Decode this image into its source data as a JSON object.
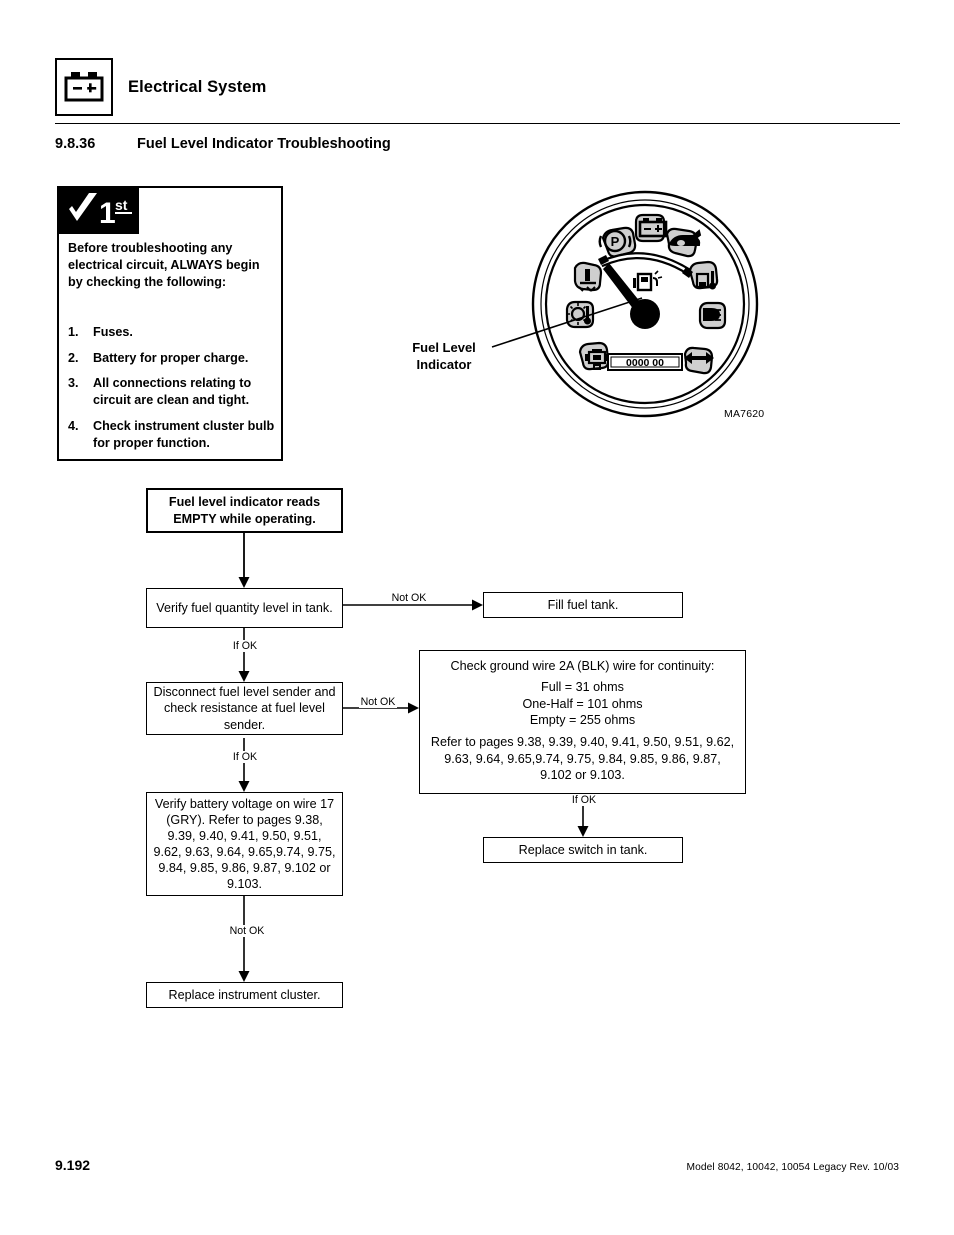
{
  "header": {
    "title": "Electrical System",
    "badge_icon": "battery-icon",
    "badge_minus": "–",
    "badge_plus": "+"
  },
  "section": {
    "number": "9.8.36",
    "title": "Fuel Level Indicator Troubleshooting"
  },
  "check_panel": {
    "flag_check": "check-mark-icon",
    "flag_text": "1",
    "flag_suffix": "st",
    "intro": "Before troubleshooting any electrical circuit, ALWAYS begin by checking the following:",
    "items": [
      {
        "num": "1.",
        "text": "Fuses."
      },
      {
        "num": "2.",
        "text": "Battery for proper charge."
      },
      {
        "num": "3.",
        "text": "All connections relating to circuit are clean and tight."
      },
      {
        "num": "4.",
        "text": "Check instrument cluster bulb for proper function."
      }
    ]
  },
  "figure": {
    "id": "MA7620",
    "callout": "Fuel Level Indicator",
    "odometer": "0000 00",
    "indicators": [
      "parking-brake-icon",
      "battery-charge-icon",
      "oil-pressure-icon",
      "hydraulic-temp-icon",
      "high-beam-icon",
      "turn-signal-icon",
      "transmission-icon",
      "coolant-temp-icon",
      "glow-plug-icon",
      "fuel-pump-icon"
    ]
  },
  "flow": {
    "start": "Fuel level indicator reads EMPTY while operating.",
    "step1": "Verify fuel quantity level in tank.",
    "step1_notok_label": "Not OK",
    "step1_result": "Fill fuel tank.",
    "step1_ok_label": "If OK",
    "step2": "Disconnect fuel level sender and check resistance at fuel level sender.",
    "step2_notok_label": "Not OK",
    "step2_ok_label": "If OK",
    "ohm_head": "Check ground wire 2A (BLK) wire for continuity:",
    "ohm_values": "Full = 31 ohms\nOne-Half = 101 ohms\nEmpty = 255 ohms",
    "ohm_refs": "Refer to pages 9.38, 9.39, 9.40, 9.41, 9.50, 9.51, 9.62, 9.63, 9.64, 9.65,9.74, 9.75, 9.84, 9.85, 9.86, 9.87, 9.102 or 9.103.",
    "ohm_ok_label": "If OK",
    "ohm_result": "Replace switch in tank.",
    "step3": "Verify battery voltage on wire 17 (GRY). Refer to pages 9.38, 9.39, 9.40, 9.41, 9.50, 9.51, 9.62, 9.63, 9.64, 9.65,9.74, 9.75, 9.84, 9.85, 9.86, 9.87, 9.102 or 9.103.",
    "step3_notok_label": "Not OK",
    "step3_result": "Replace instrument cluster."
  },
  "footer": {
    "page": "9.192",
    "model": "Model  8042, 10042, 10054 Legacy   Rev.  10/03"
  }
}
